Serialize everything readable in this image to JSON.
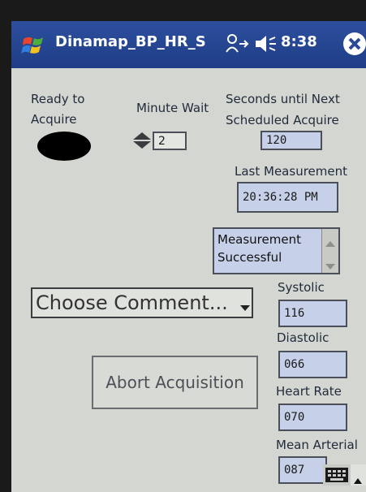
{
  "titlebar": {
    "title": "Dinamap_BP_HR_S",
    "time": "8:38"
  },
  "status": {
    "ready_label_1": "Ready to",
    "ready_label_2": "Acquire"
  },
  "minute_wait": {
    "label": "Minute Wait",
    "value": "2"
  },
  "next_acquire": {
    "label_1": "Seconds until Next",
    "label_2": "Scheduled Acquire",
    "value": "120"
  },
  "last_measurement": {
    "label": "Last Measurement",
    "value": "20:36:28 PM"
  },
  "message": {
    "line_1": "Measurement",
    "line_2": "Successful"
  },
  "comment": {
    "selected": "Choose Comment..."
  },
  "abort_label": "Abort Acquisition",
  "vitals": {
    "systolic_label": "Systolic",
    "systolic": "116",
    "diastolic_label": "Diastolic",
    "diastolic": "066",
    "heart_rate_label": "Heart Rate",
    "heart_rate": "070",
    "mean_arterial_label": "Mean Arterial",
    "mean_arterial": "087"
  },
  "icons": {
    "start": "windows-flag-icon",
    "connectivity": "connectivity-icon",
    "volume": "speaker-icon",
    "close": "close-icon",
    "keyboard": "keyboard-icon"
  }
}
